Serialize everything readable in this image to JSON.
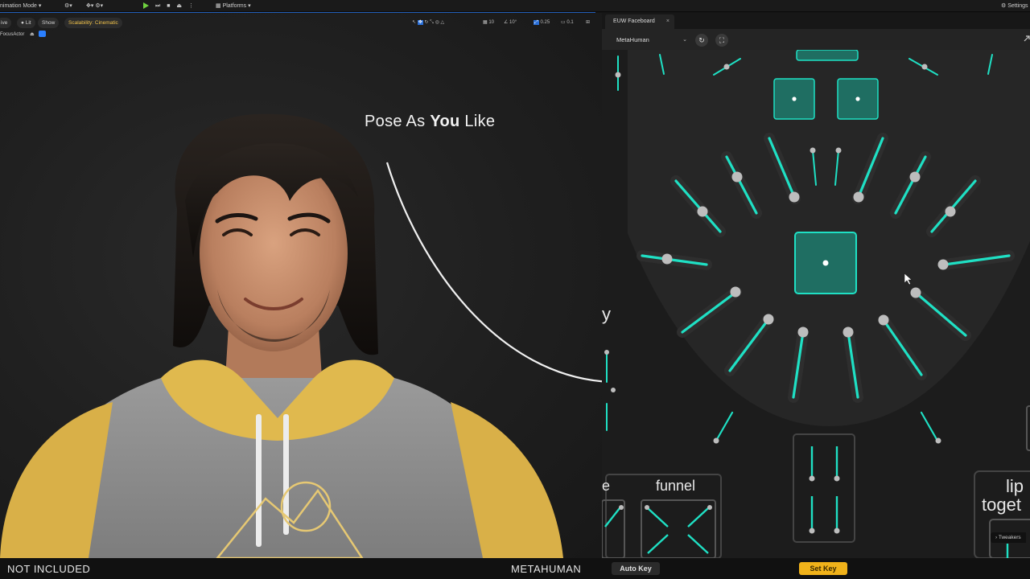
{
  "toolbar": {
    "mode_label": "nimation Mode",
    "platforms_label": "Platforms",
    "settings_label": "Settings"
  },
  "viewport": {
    "view_label": "ive",
    "lit_label": "Lit",
    "show_label": "Show",
    "scalability_label": "Scalability: Cinematic",
    "focus_actor_label": "FocusActor",
    "grid_value": "10",
    "angle_value": "10°",
    "scale_value": "0.25",
    "camera_speed_value": "0.1"
  },
  "headline": {
    "part1": "Pose As ",
    "emph": "You",
    "part2": " Like"
  },
  "panel": {
    "tab_title": "EUW Faceboard",
    "tab_close": "×",
    "preset_value": "MetaHuman",
    "labels": {
      "funnel": "funnel",
      "left_partial": "e",
      "y_partial": "y",
      "lips": "lip",
      "together": "toget"
    },
    "tweakers_label": "Tweakers"
  },
  "bottom": {
    "left_text": "NOT INCLUDED",
    "mid_text": "METAHUMAN",
    "auto_key_label": "Auto Key",
    "set_key_label": "Set Key"
  },
  "colors": {
    "accent_teal": "#1fe0c4",
    "set_key": "#f0b21a",
    "play": "#6fd13f",
    "scalability": "#f0c24a"
  }
}
